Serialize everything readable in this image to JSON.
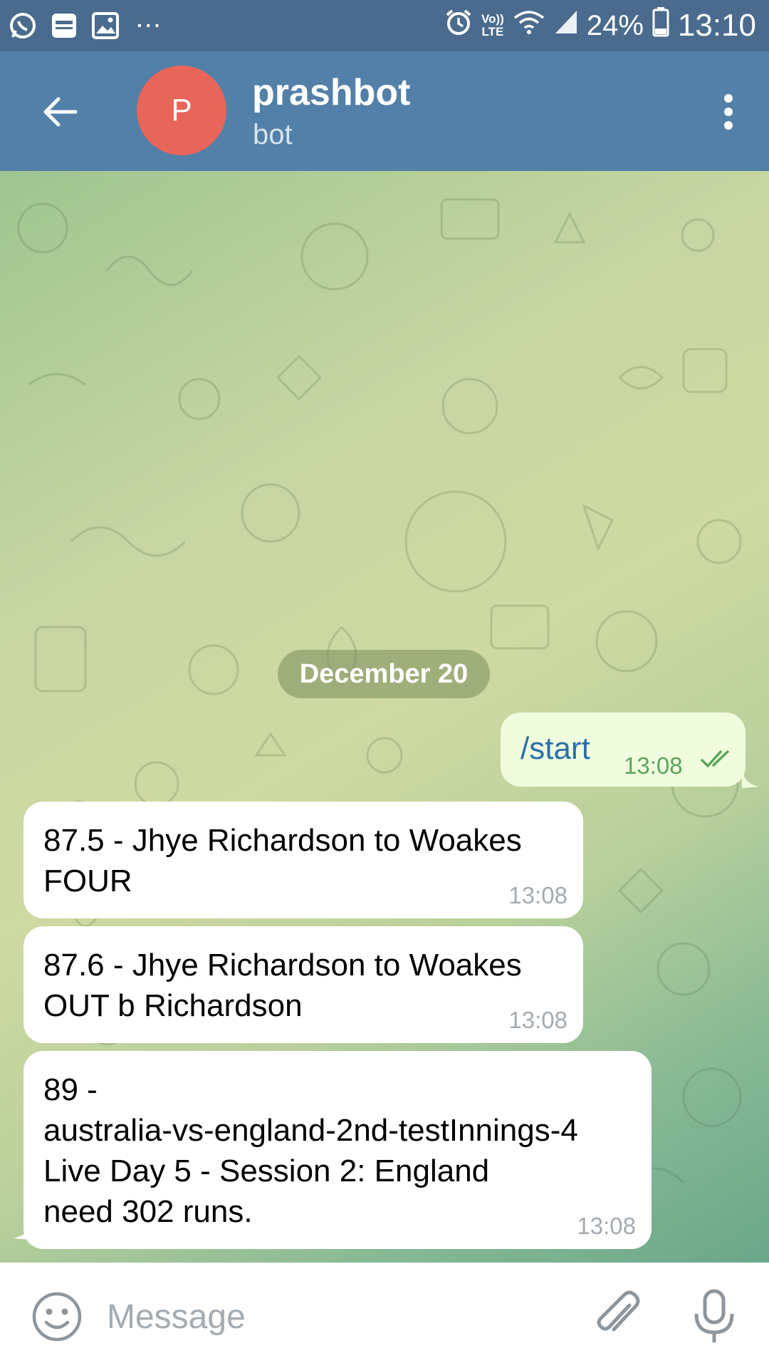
{
  "status_bar": {
    "left_icons": [
      "whatsapp-icon",
      "icici-icon",
      "gallery-icon"
    ],
    "more": "···",
    "volte_top": "Vo))",
    "volte_bottom": "LTE",
    "battery_percent": "24%",
    "time": "13:10"
  },
  "header": {
    "avatar_letter": "P",
    "title": "prashbot",
    "subtitle": "bot",
    "colors": {
      "header": "#5280a8",
      "status_bar": "#4a6b8d",
      "avatar": "#e8655a"
    }
  },
  "chat": {
    "date_chip": "December 20",
    "outgoing": [
      {
        "text": "/start",
        "time": "13:08",
        "status": "read"
      }
    ],
    "incoming": [
      {
        "text": "87.5 - Jhye Richardson to Woakes\nFOUR",
        "time": "13:08"
      },
      {
        "text": "87.6 - Jhye Richardson to Woakes\nOUT  b Richardson",
        "time": "13:08"
      },
      {
        "text": "89 -\naustralia-vs-england-2nd-testInnings-4\nLive Day 5 - Session 2: England\nneed 302 runs.",
        "time": "13:08"
      }
    ]
  },
  "input": {
    "placeholder": "Message",
    "value": ""
  }
}
